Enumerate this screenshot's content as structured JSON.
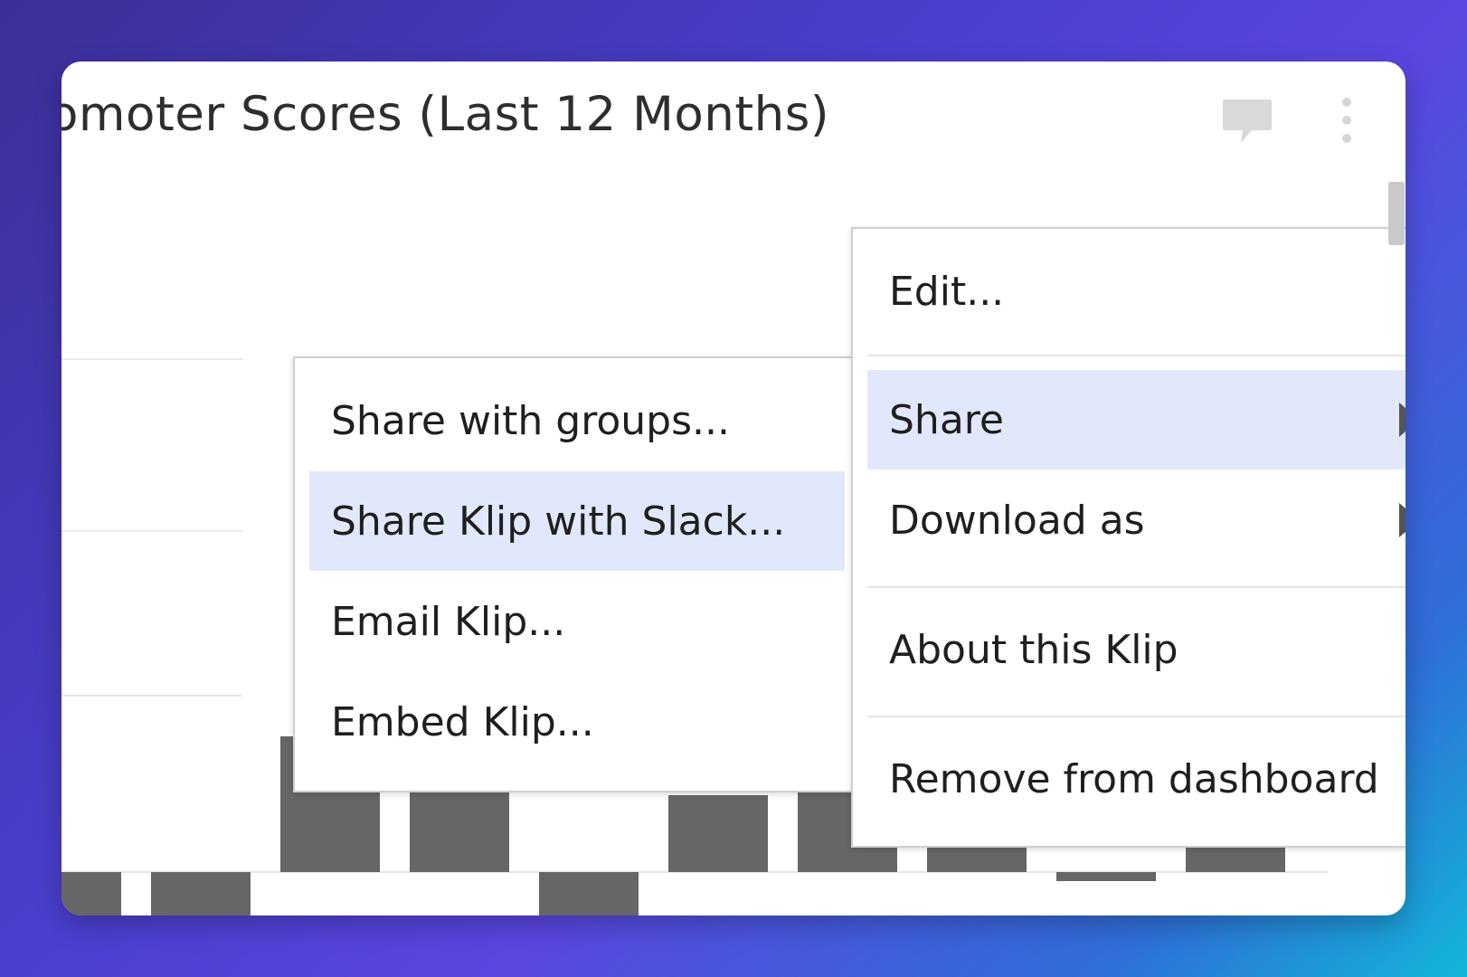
{
  "klip": {
    "title": "omoter Scores (Last 12 Months)",
    "comment_icon": "comment-icon",
    "menu_icon": "more-vertical-icon"
  },
  "chart_data": {
    "type": "bar",
    "values": [
      -1,
      -1,
      3,
      2,
      -1,
      1.7,
      1.8,
      1.8,
      -0.2,
      1.5
    ],
    "ylim": [
      -1.5,
      5.5
    ],
    "color": "#666666"
  },
  "context_menu": {
    "items": [
      {
        "label": "Edit..."
      },
      {
        "label": "Share",
        "has_submenu": true,
        "highlighted": true
      },
      {
        "label": "Download as",
        "has_submenu": true
      },
      {
        "label": "About this Klip"
      },
      {
        "label": "Remove from dashboard"
      }
    ]
  },
  "share_submenu": {
    "items": [
      {
        "label": "Share with groups..."
      },
      {
        "label": "Share Klip with Slack...",
        "highlighted": true
      },
      {
        "label": "Email Klip..."
      },
      {
        "label": "Embed Klip..."
      }
    ]
  },
  "colors": {
    "highlight": "#e2e8fb",
    "bar": "#666666",
    "background_gradient": [
      "#3b2f97",
      "#5a46e0",
      "#12b6d8"
    ]
  }
}
